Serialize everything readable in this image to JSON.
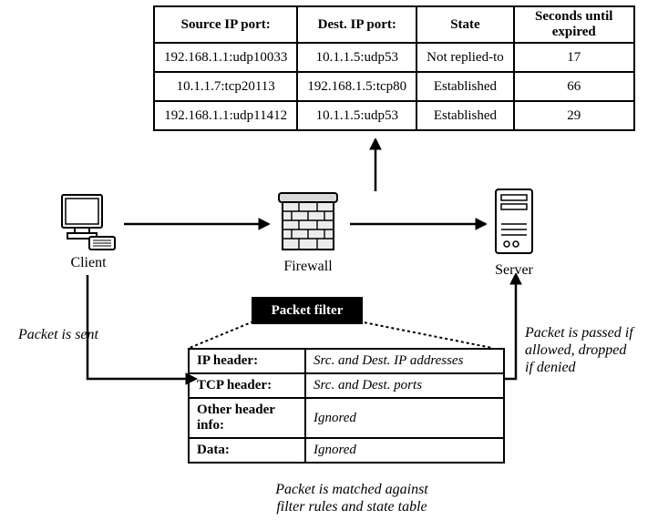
{
  "state_table": {
    "headers": [
      "Source IP port:",
      "Dest. IP port:",
      "State",
      "Seconds until expired"
    ],
    "rows": [
      [
        "192.168.1.1:udp10033",
        "10.1.1.5:udp53",
        "Not replied-to",
        "17"
      ],
      [
        "10.1.1.7:tcp20113",
        "192.168.1.5:tcp80",
        "Established",
        "66"
      ],
      [
        "192.168.1.1:udp11412",
        "10.1.1.5:udp53",
        "Established",
        "29"
      ]
    ]
  },
  "nodes": {
    "client": "Client",
    "firewall": "Firewall",
    "server": "Server"
  },
  "packet_filter": {
    "tag": "Packet filter",
    "rows": [
      [
        "IP header:",
        "Src. and Dest. IP addresses"
      ],
      [
        "TCP header:",
        "Src. and Dest. ports"
      ],
      [
        "Other header info:",
        "Ignored"
      ],
      [
        "Data:",
        "Ignored"
      ]
    ]
  },
  "notes": {
    "sent": "Packet is sent",
    "passed_l1": "Packet is passed if",
    "passed_l2": "allowed, dropped",
    "passed_l3": "if denied",
    "matched_l1": "Packet is matched against",
    "matched_l2": "filter rules and state table"
  }
}
